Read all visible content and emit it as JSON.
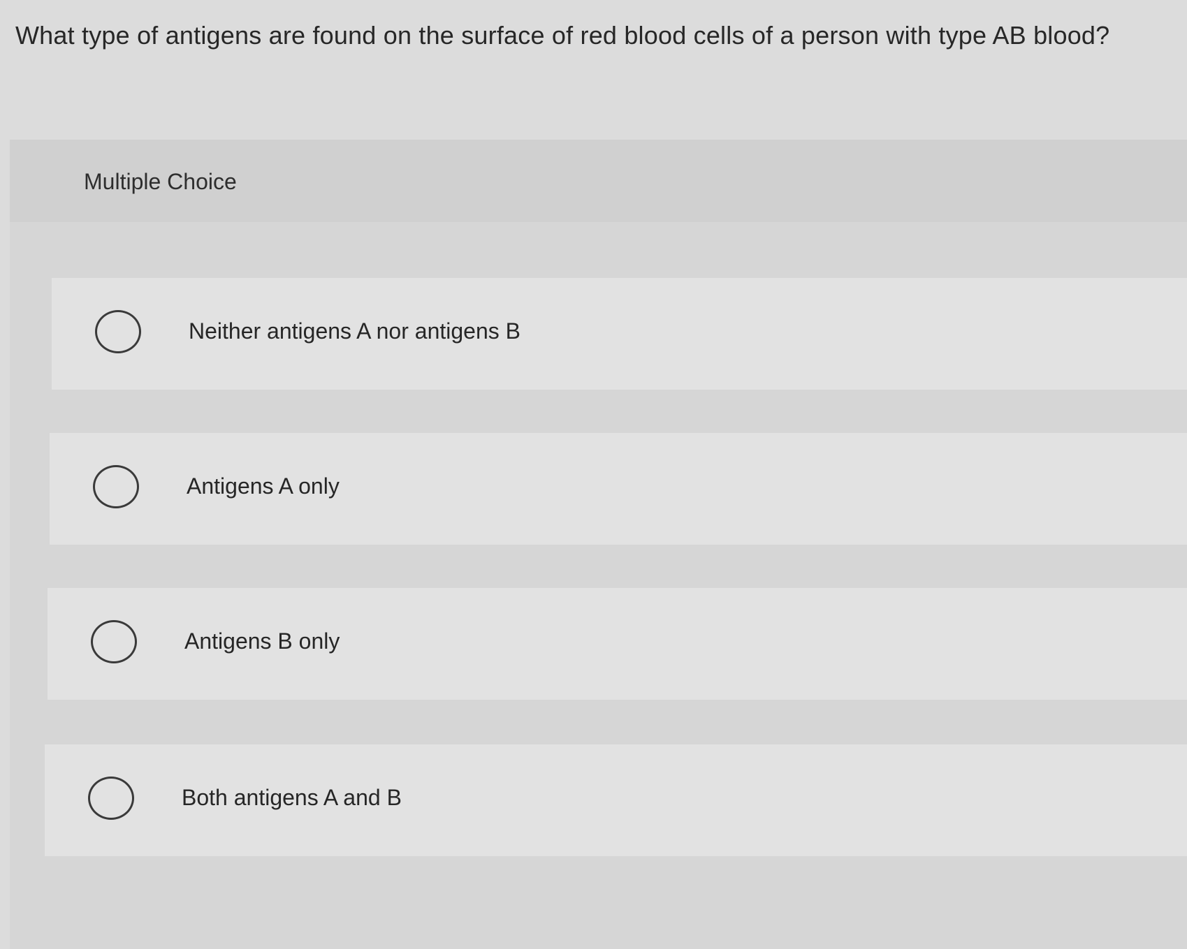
{
  "question": {
    "text": "What type of antigens are found on the surface of red blood cells of a person with type AB blood?"
  },
  "panel": {
    "title": "Multiple Choice"
  },
  "choices": [
    {
      "label": "Neither antigens A nor antigens B",
      "selected": false
    },
    {
      "label": "Antigens A only",
      "selected": false
    },
    {
      "label": "Antigens B only",
      "selected": false
    },
    {
      "label": "Both antigens A and B",
      "selected": false
    }
  ]
}
